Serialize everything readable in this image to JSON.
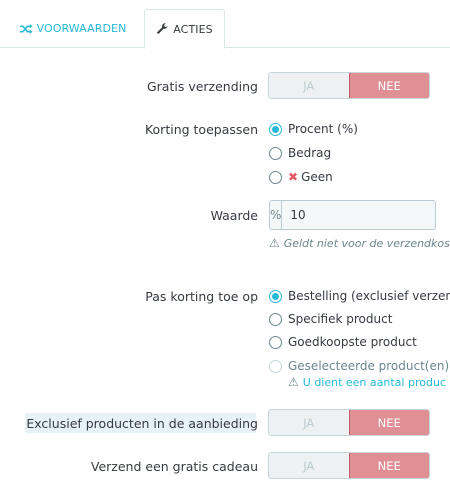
{
  "tabs": [
    {
      "label": "VOORWAARDEN",
      "icon": "shuffle-icon"
    },
    {
      "label": "ACTIES",
      "icon": "wrench-icon"
    }
  ],
  "free_shipping": {
    "label": "Gratis verzending",
    "yes": "JA",
    "no": "NEE",
    "selected": "no"
  },
  "apply_discount": {
    "label": "Korting toepassen",
    "options": [
      {
        "label": "Procent (%)",
        "checked": true
      },
      {
        "label": "Bedrag",
        "checked": false
      },
      {
        "label": "Geen",
        "checked": false,
        "icon": "close-icon"
      }
    ]
  },
  "value": {
    "label": "Waarde",
    "addon": "%",
    "input_value": "10",
    "help": "Geldt niet voor de verzendkoste"
  },
  "apply_discount_to": {
    "label": "Pas korting toe op",
    "options": [
      {
        "label": "Bestelling (exclusief verzendk",
        "checked": true
      },
      {
        "label": "Specifiek product",
        "checked": false
      },
      {
        "label": "Goedkoopste product",
        "checked": false
      },
      {
        "label": "Geselecteerde product(en)",
        "checked": false,
        "disabled": true
      }
    ],
    "help": "U dient een aantal produc"
  },
  "exclude_discounted": {
    "label": "Exclusief producten in de aanbieding",
    "yes": "JA",
    "no": "NEE",
    "selected": "no"
  },
  "free_gift": {
    "label": "Verzend een gratis cadeau",
    "yes": "JA",
    "no": "NEE",
    "selected": "no"
  },
  "colors": {
    "accent": "#25b9d7",
    "toggle_no_bg": "#e08f95",
    "danger_icon": "#e5596a"
  }
}
